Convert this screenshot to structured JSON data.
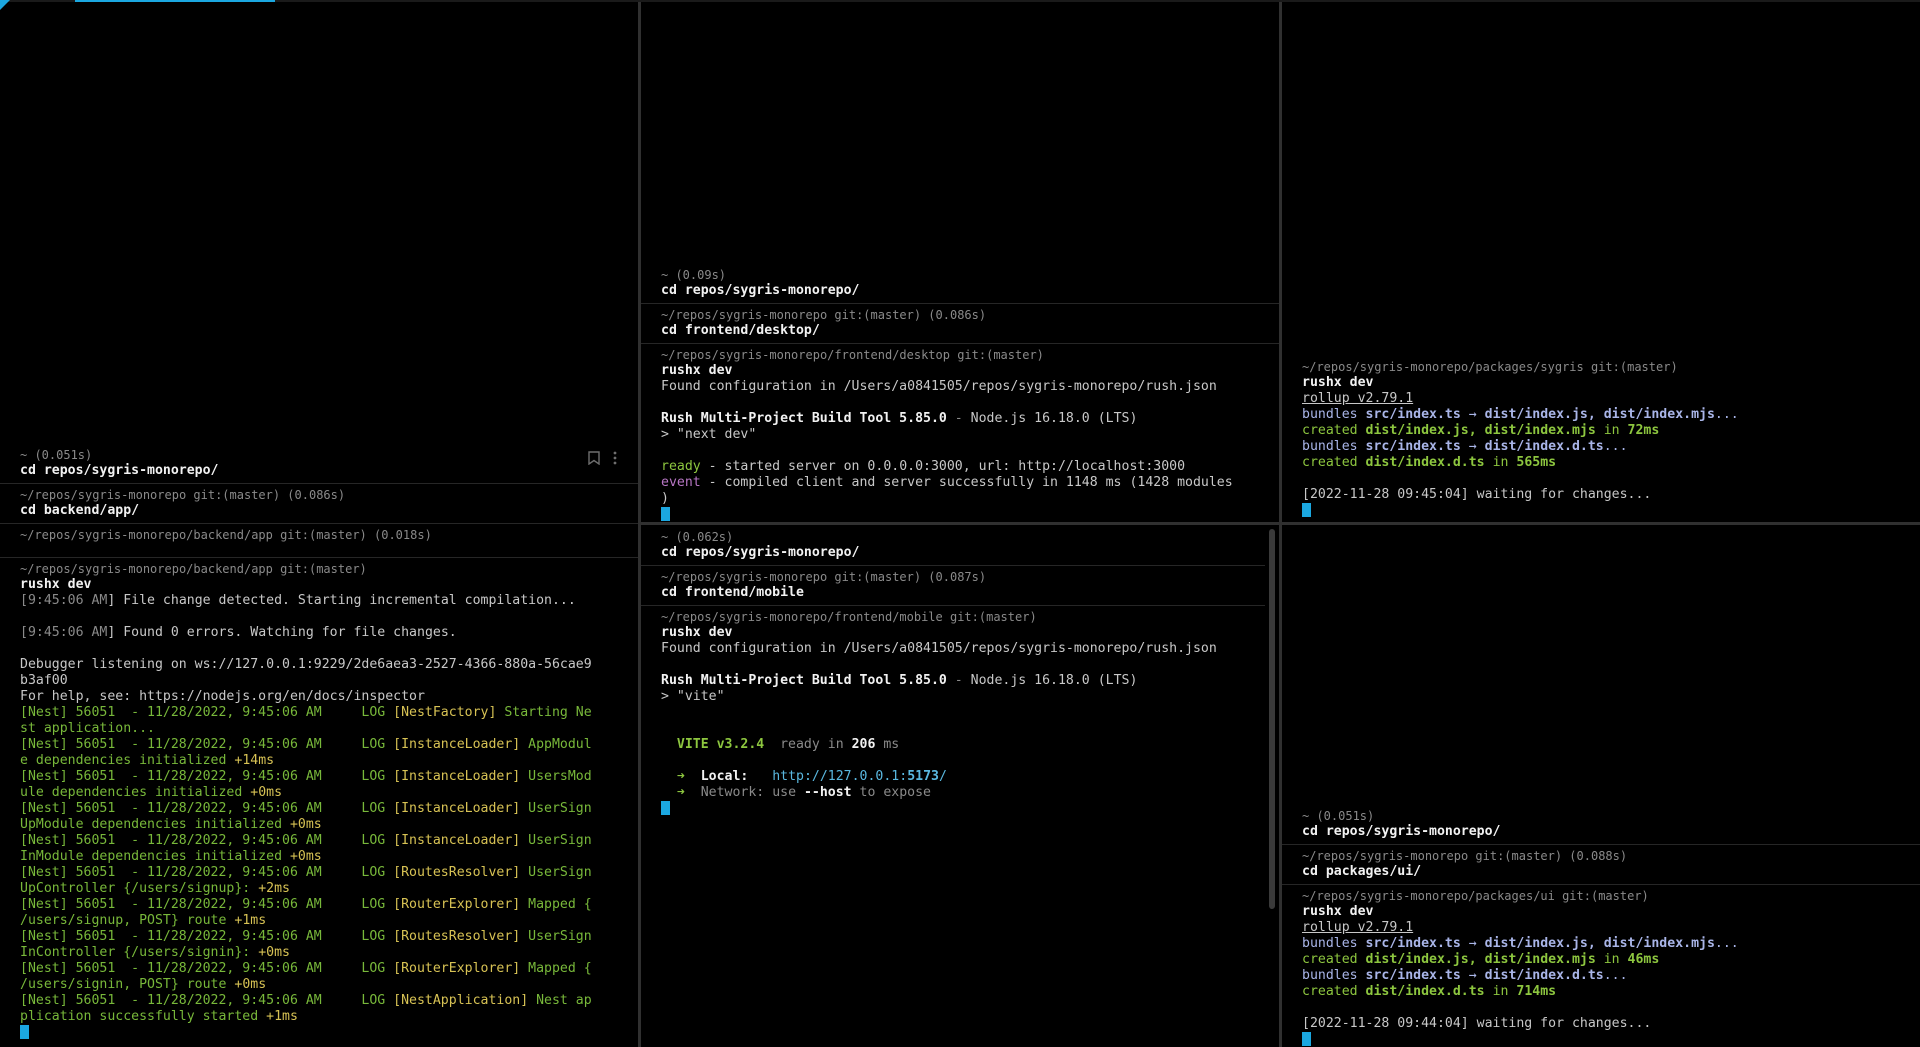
{
  "app": {
    "accent_color": "#1ba7e0"
  },
  "pane_top_left": {
    "blocks": [
      {
        "prompt": "~ (0.051s)",
        "command": "cd repos/sygris-monorepo/"
      },
      {
        "prompt": "~/repos/sygris-monorepo git:(master) (0.086s)",
        "command": "cd backend/app/"
      },
      {
        "prompt": "~/repos/sygris-monorepo/backend/app git:(master) (0.018s)",
        "command": ""
      },
      {
        "prompt": "~/repos/sygris-monorepo/backend/app git:(master)",
        "command": "rushx dev"
      }
    ],
    "output": {
      "l1_time": "9:45:06 AM",
      "l1_text": "] File change detected. Starting incremental compilation...",
      "l2_time": "9:45:06 AM",
      "l2_text": "] Found 0 errors. Watching for file changes.",
      "l3": "Debugger listening on ws://127.0.0.1:9229/2de6aea3-2527-4366-880a-56cae9",
      "l4": "b3af00",
      "l5": "For help, see: https://nodejs.org/en/docs/inspector",
      "nest": [
        {
          "head": "[Nest] 56051  - 11/28/2022, 9:45:06 AM     ",
          "level": "LOG",
          "ctx": " [NestFactory] ",
          "msg1": "Starting Ne",
          "msg2": "st application...",
          "timing": ""
        },
        {
          "head": "[Nest] 56051  - 11/28/2022, 9:45:06 AM     ",
          "level": "LOG",
          "ctx": " [InstanceLoader] ",
          "msg1": "AppModul",
          "msg2": "e dependencies initialized ",
          "timing": "+14ms"
        },
        {
          "head": "[Nest] 56051  - 11/28/2022, 9:45:06 AM     ",
          "level": "LOG",
          "ctx": " [InstanceLoader] ",
          "msg1": "UsersMod",
          "msg2": "ule dependencies initialized ",
          "timing": "+0ms"
        },
        {
          "head": "[Nest] 56051  - 11/28/2022, 9:45:06 AM     ",
          "level": "LOG",
          "ctx": " [InstanceLoader] ",
          "msg1": "UserSign",
          "msg2": "UpModule dependencies initialized ",
          "timing": "+0ms"
        },
        {
          "head": "[Nest] 56051  - 11/28/2022, 9:45:06 AM     ",
          "level": "LOG",
          "ctx": " [InstanceLoader] ",
          "msg1": "UserSign",
          "msg2": "InModule dependencies initialized ",
          "timing": "+0ms"
        },
        {
          "head": "[Nest] 56051  - 11/28/2022, 9:45:06 AM     ",
          "level": "LOG",
          "ctx": " [RoutesResolver] ",
          "msg1": "UserSign",
          "msg2": "UpController {/users/signup}: ",
          "timing": "+2ms"
        },
        {
          "head": "[Nest] 56051  - 11/28/2022, 9:45:06 AM     ",
          "level": "LOG",
          "ctx": " [RouterExplorer] ",
          "msg1": "Mapped {",
          "msg2": "/users/signup, POST} route ",
          "timing": "+1ms"
        },
        {
          "head": "[Nest] 56051  - 11/28/2022, 9:45:06 AM     ",
          "level": "LOG",
          "ctx": " [RoutesResolver] ",
          "msg1": "UserSign",
          "msg2": "InController {/users/signin}: ",
          "timing": "+0ms"
        },
        {
          "head": "[Nest] 56051  - 11/28/2022, 9:45:06 AM     ",
          "level": "LOG",
          "ctx": " [RouterExplorer] ",
          "msg1": "Mapped {",
          "msg2": "/users/signin, POST} route ",
          "timing": "+0ms"
        },
        {
          "head": "[Nest] 56051  - 11/28/2022, 9:45:06 AM     ",
          "level": "LOG",
          "ctx": " [NestApplication] ",
          "msg1": "Nest ap",
          "msg2": "plication successfully started ",
          "timing": "+1ms"
        }
      ]
    }
  },
  "pane_top_middle": {
    "blocks": [
      {
        "prompt": "~ (0.09s)",
        "command": "cd repos/sygris-monorepo/"
      },
      {
        "prompt": "~/repos/sygris-monorepo git:(master) (0.086s)",
        "command": "cd frontend/desktop/"
      },
      {
        "prompt": "~/repos/sygris-monorepo/frontend/desktop git:(master)",
        "command": "rushx dev"
      }
    ],
    "output": {
      "found": "Found configuration in /Users/a0841505/repos/sygris-monorepo/rush.json",
      "rush_name": "Rush Multi-Project Build Tool 5.85.0",
      "rush_sep": " - ",
      "rush_node": "Node.js 16.18.0 (LTS)",
      "script": "> \"next dev\"",
      "ready_label": "ready",
      "ready_text": " - started server on 0.0.0.0:3000, url: http://localhost:3000",
      "event_label": "event",
      "event_text": " - compiled client and server successfully in 1148 ms (1428 modules",
      "event_wrap": ")"
    }
  },
  "pane_top_right": {
    "blocks": [
      {
        "prompt": "~/repos/sygris-monorepo/packages/sygris git:(master)",
        "command": "rushx dev"
      }
    ],
    "output": {
      "rollup": "rollup v2.79.1",
      "b1_label": "bundles ",
      "b1_src": "src/index.ts",
      "b1_arrow": " → ",
      "b1_dst": "dist/index.js, dist/index.mjs",
      "b1_dots": "...",
      "c1_label": "created ",
      "c1_files": "dist/index.js, dist/index.mjs",
      "c1_in": " in ",
      "c1_time": "72ms",
      "b2_label": "bundles ",
      "b2_src": "src/index.ts",
      "b2_arrow": " → ",
      "b2_dst": "dist/index.d.ts",
      "b2_dots": "...",
      "c2_label": "created ",
      "c2_files": "dist/index.d.ts",
      "c2_in": " in ",
      "c2_time": "565ms",
      "waiting": "[2022-11-28 09:45:04] waiting for changes..."
    }
  },
  "pane_bottom_middle": {
    "blocks": [
      {
        "prompt": "~ (0.062s)",
        "command": "cd repos/sygris-monorepo/"
      },
      {
        "prompt": "~/repos/sygris-monorepo git:(master) (0.087s)",
        "command": "cd frontend/mobile"
      },
      {
        "prompt": "~/repos/sygris-monorepo/frontend/mobile git:(master)",
        "command": "rushx dev"
      }
    ],
    "output": {
      "found": "Found configuration in /Users/a0841505/repos/sygris-monorepo/rush.json",
      "rush_name": "Rush Multi-Project Build Tool 5.85.0",
      "rush_sep": " - ",
      "rush_node": "Node.js 16.18.0 (LTS)",
      "script": "> \"vite\"",
      "vite_name": "VITE v3.2.4",
      "vite_ready": "  ready in ",
      "vite_ms": "206",
      "vite_ms_unit": " ms",
      "arrow": "➜",
      "local_label": "Local:",
      "local_url_a": "http://127.0.0.1:",
      "local_url_port": "5173",
      "local_url_b": "/",
      "network_text": "Network: use ",
      "network_flag": "--host",
      "network_tail": " to expose"
    }
  },
  "pane_bottom_right": {
    "blocks": [
      {
        "prompt": "~ (0.051s)",
        "command": "cd repos/sygris-monorepo/"
      },
      {
        "prompt": "~/repos/sygris-monorepo git:(master) (0.088s)",
        "command": "cd packages/ui/"
      },
      {
        "prompt": "~/repos/sygris-monorepo/packages/ui git:(master)",
        "command": "rushx dev"
      }
    ],
    "output": {
      "rollup": "rollup v2.79.1",
      "b1_label": "bundles ",
      "b1_src": "src/index.ts",
      "b1_arrow": " → ",
      "b1_dst": "dist/index.js, dist/index.mjs",
      "b1_dots": "...",
      "c1_label": "created ",
      "c1_files": "dist/index.js, dist/index.mjs",
      "c1_in": " in ",
      "c1_time": "46ms",
      "b2_label": "bundles ",
      "b2_src": "src/index.ts",
      "b2_arrow": " → ",
      "b2_dst": "dist/index.d.ts",
      "b2_dots": "...",
      "c2_label": "created ",
      "c2_files": "dist/index.d.ts",
      "c2_in": " in ",
      "c2_time": "714ms",
      "waiting": "[2022-11-28 09:44:04] waiting for changes..."
    }
  },
  "icons": {
    "bookmark": "bookmark-icon",
    "more": "more-vertical-icon"
  }
}
